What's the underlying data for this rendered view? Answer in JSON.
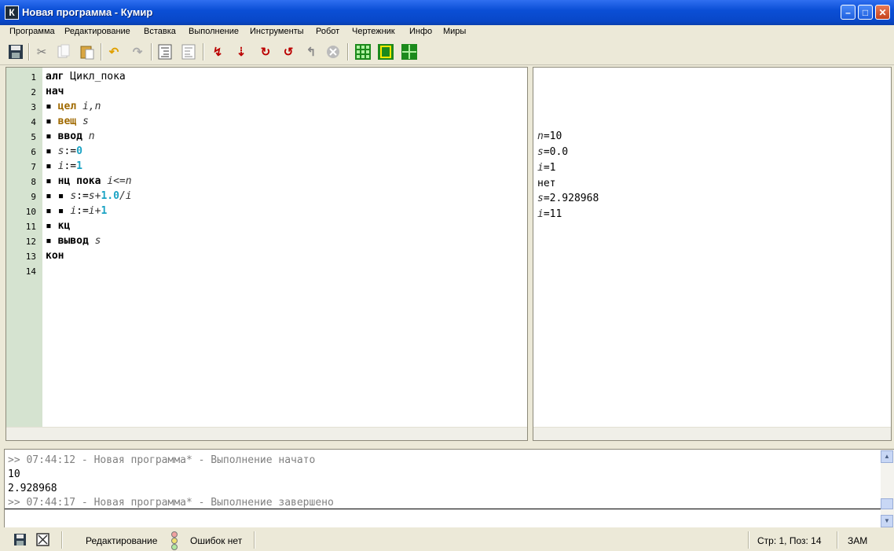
{
  "window": {
    "title": "Новая программа - Кумир",
    "icon_letter": "К"
  },
  "menu": [
    "Программа",
    "Редактирование",
    "Вставка",
    "Выполнение",
    "Инструменты",
    "Робот",
    "Чертежник",
    "Инфо",
    "Миры"
  ],
  "editor": {
    "line_numbers": [
      "1",
      "2",
      "3",
      "4",
      "5",
      "6",
      "7",
      "8",
      "9",
      "10",
      "11",
      "12",
      "13",
      "14"
    ],
    "lines": [
      {
        "indent": "",
        "t1": "алг",
        "t2": " Цикл_пока"
      },
      {
        "indent": "",
        "t1": "нач"
      },
      {
        "indent": "▪ ",
        "t1": "цел",
        "v1": " i,n"
      },
      {
        "indent": "▪ ",
        "t1": "вещ",
        "v1": " s"
      },
      {
        "indent": "▪ ",
        "t1": "ввод",
        "v1": " n"
      },
      {
        "indent": "▪ ",
        "v1": "s",
        "op": ":=",
        "n1": "0"
      },
      {
        "indent": "▪ ",
        "v1": "i",
        "op": ":=",
        "n1": "1"
      },
      {
        "indent": "▪ ",
        "t1": "нц пока",
        "v1": " i<=n"
      },
      {
        "indent": "▪ ▪ ",
        "v1": "s",
        "op": ":=",
        "v2": "s+",
        "n1": "1.0",
        "v3": "/i"
      },
      {
        "indent": "▪ ▪ ",
        "v1": "i",
        "op": ":=",
        "v2": "i+",
        "n1": "1"
      },
      {
        "indent": "▪ ",
        "t1": "кц"
      },
      {
        "indent": "▪ ",
        "t1": "вывод",
        "v1": " s"
      },
      {
        "indent": "",
        "t1": "кон"
      }
    ]
  },
  "output": {
    "lines": [
      {
        "v": "n",
        "rest": "=10"
      },
      {
        "v": "s",
        "rest": "=0.0"
      },
      {
        "v": "i",
        "rest": "=1"
      },
      {
        "v": "",
        "rest": "нет"
      },
      {
        "v": "s",
        "rest": "=2.928968"
      },
      {
        "v": "i",
        "rest": "=11"
      }
    ]
  },
  "console": {
    "lines": [
      {
        "text": ">> 07:44:12 - Новая программа* - Выполнение начато",
        "grey": true
      },
      {
        "text": "10",
        "grey": false
      },
      {
        "text": "2.928968",
        "grey": false
      },
      {
        "text": ">> 07:44:17 - Новая программа* - Выполнение завершено",
        "grey": true
      }
    ]
  },
  "status": {
    "mode": "Редактирование",
    "errors": "Ошибок нет",
    "position": "Стр: 1, Поз: 14",
    "caps": "ЗАМ"
  },
  "colors": {
    "titlebar": "#0b4fd6",
    "gutter": "#d5e3d0",
    "keyword_type": "#a06a00",
    "number": "#1aa3c4"
  }
}
